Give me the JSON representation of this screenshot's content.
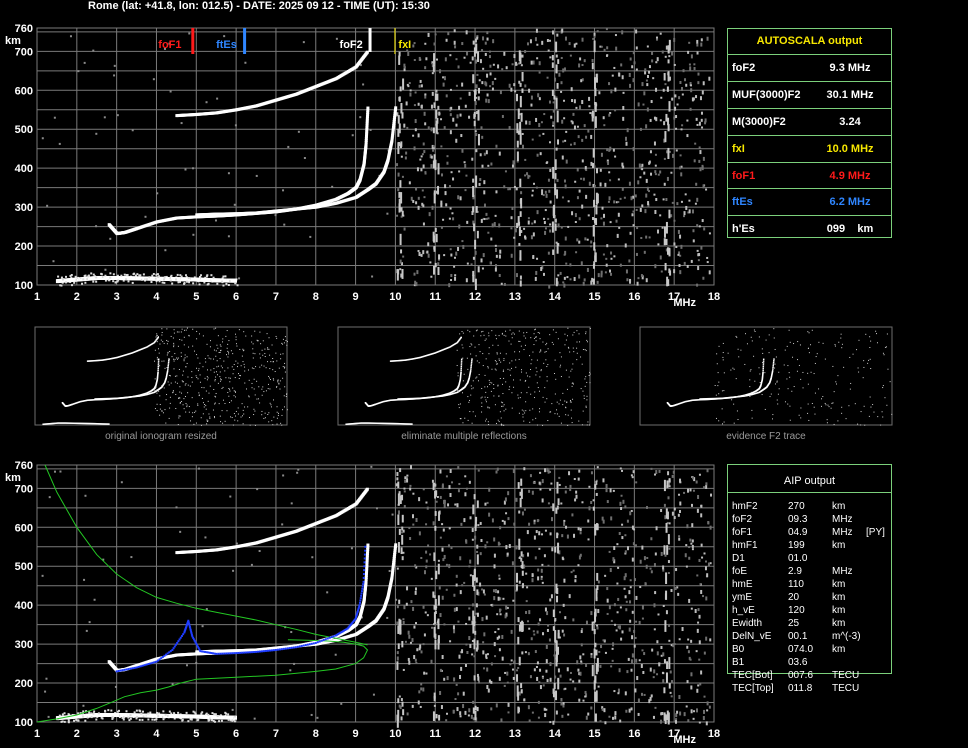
{
  "header": "Rome (lat: +41.8, lon: 012.5) - DATE: 2025 09 12 - TIME (UT): 15:30",
  "colors": {
    "grid": "#7a7a7a",
    "trace": "#ffffff",
    "green": "#23c623",
    "blue": "#1f3dff",
    "yellow": "#f7e700",
    "red": "#ff1a1a",
    "lightblue": "#2f86ff",
    "panel_border": "#7bd07b"
  },
  "chart_data": [
    {
      "type": "scatter",
      "title": "",
      "xlabel": "MHz",
      "ylabel": "km",
      "xlim": [
        1,
        18
      ],
      "ylim": [
        100,
        760
      ],
      "x_ticks": [
        "1",
        "2",
        "3",
        "4",
        "5",
        "6",
        "7",
        "8",
        "9",
        "10",
        "11",
        "12",
        "13",
        "14",
        "15",
        "16",
        "17",
        "18"
      ],
      "y_ticks": [
        "100",
        "200",
        "300",
        "400",
        "500",
        "600",
        "700",
        "760"
      ],
      "grid": true,
      "markers": [
        {
          "name": "foF1",
          "x": 4.9,
          "color": "#ff1a1a"
        },
        {
          "name": "ftEs",
          "x": 6.2,
          "color": "#2f86ff"
        },
        {
          "name": "foF2",
          "x": 9.3,
          "color": "#ffffff"
        },
        {
          "name": "fxI",
          "x": 10.0,
          "color": "#f7e700"
        }
      ],
      "series": [
        {
          "name": "O-trace",
          "x": [
            2.8,
            3.0,
            3.2,
            3.5,
            4.0,
            4.5,
            5.0,
            5.5,
            6.0,
            6.5,
            7.0,
            7.5,
            8.0,
            8.5,
            8.8,
            9.0,
            9.1,
            9.2,
            9.25,
            9.3
          ],
          "y": [
            255,
            232,
            235,
            245,
            262,
            272,
            275,
            277,
            280,
            284,
            288,
            295,
            305,
            320,
            335,
            350,
            370,
            410,
            460,
            560
          ]
        },
        {
          "name": "X-trace",
          "x": [
            5.0,
            5.5,
            6.0,
            6.5,
            7.0,
            7.5,
            8.0,
            8.5,
            9.0,
            9.3,
            9.5,
            9.7,
            9.8,
            9.9,
            10.0
          ],
          "y": [
            280,
            282,
            283,
            285,
            290,
            295,
            300,
            310,
            325,
            345,
            360,
            390,
            420,
            470,
            560
          ]
        },
        {
          "name": "multiple-reflection",
          "x": [
            4.5,
            5.0,
            5.5,
            6.0,
            6.5,
            7.0,
            7.5,
            8.0,
            8.5,
            9.0,
            9.3
          ],
          "y": [
            535,
            538,
            542,
            550,
            560,
            575,
            590,
            610,
            630,
            660,
            700
          ]
        },
        {
          "name": "E-layer",
          "x": [
            1.5,
            2.0,
            2.5,
            3.0,
            3.5,
            4.0,
            4.5,
            5.0,
            5.5,
            6.0
          ],
          "y": [
            110,
            114,
            118,
            118,
            117,
            116,
            115,
            114,
            112,
            111
          ]
        }
      ]
    },
    {
      "type": "line",
      "title": "",
      "xlabel": "MHz",
      "ylabel": "km",
      "xlim": [
        1,
        18
      ],
      "ylim": [
        100,
        760
      ],
      "x_ticks": [
        "1",
        "2",
        "3",
        "4",
        "5",
        "6",
        "7",
        "8",
        "9",
        "10",
        "11",
        "12",
        "13",
        "14",
        "15",
        "16",
        "17",
        "18"
      ],
      "y_ticks": [
        "100",
        "200",
        "300",
        "400",
        "500",
        "600",
        "700",
        "760"
      ],
      "grid": true,
      "series": [
        {
          "name": "MUF curve",
          "color": "#23c623",
          "x": [
            1.2,
            1.5,
            2.0,
            2.5,
            3.0,
            3.5,
            4.0,
            4.5,
            5.0,
            5.5,
            6.0,
            6.5,
            7.0,
            7.5,
            8.0,
            8.5,
            9.0,
            9.3
          ],
          "y": [
            760,
            690,
            600,
            530,
            480,
            445,
            420,
            405,
            392,
            382,
            372,
            362,
            350,
            338,
            325,
            315,
            305,
            298
          ]
        },
        {
          "name": "Profile",
          "color": "#23c623",
          "x": [
            1.0,
            1.5,
            2.0,
            2.5,
            2.9,
            3.2,
            3.6,
            4.0,
            4.3,
            4.6,
            5.0,
            6.0,
            7.0,
            8.0,
            8.5,
            9.0,
            9.2,
            9.3,
            9.2,
            9.0,
            8.7,
            8.3,
            7.8,
            7.3
          ],
          "y": [
            100,
            108,
            118,
            135,
            152,
            165,
            175,
            182,
            190,
            200,
            210,
            215,
            220,
            230,
            236,
            250,
            265,
            285,
            295,
            300,
            305,
            308,
            310,
            311
          ]
        },
        {
          "name": "Scaled O-trace",
          "color": "#1f3dff",
          "x": [
            3.0,
            3.5,
            4.0,
            4.4,
            4.7,
            4.8,
            4.9,
            5.1,
            5.5,
            6.0,
            6.5,
            7.0,
            7.5,
            8.0,
            8.5,
            8.8,
            9.0,
            9.1,
            9.2,
            9.25
          ],
          "y": [
            230,
            240,
            255,
            285,
            330,
            360,
            320,
            282,
            275,
            277,
            280,
            285,
            292,
            303,
            322,
            340,
            365,
            400,
            460,
            560
          ]
        }
      ]
    }
  ],
  "mini_panels": [
    {
      "caption": "original ionogram resized"
    },
    {
      "caption": "eliminate multiple reflections"
    },
    {
      "caption": "evidence F2 trace"
    }
  ],
  "autoscala": {
    "title": "AUTOSCALA output",
    "rows": [
      {
        "label": "foF2",
        "value": "9.3 MHz",
        "color": "#ffffff"
      },
      {
        "label": "MUF(3000)F2",
        "value": "30.1 MHz",
        "color": "#ffffff"
      },
      {
        "label": "M(3000)F2",
        "value": "3.24",
        "color": "#ffffff"
      },
      {
        "label": "fxI",
        "value": "10.0 MHz",
        "color": "#f7e700"
      },
      {
        "label": "foF1",
        "value": "4.9 MHz",
        "color": "#ff1a1a"
      },
      {
        "label": "ftEs",
        "value": "6.2 MHz",
        "color": "#2f86ff"
      },
      {
        "label": "h'Es",
        "value": "099    km",
        "color": "#ffffff"
      }
    ]
  },
  "aip": {
    "title": "AIP output",
    "rows": [
      {
        "label": "hmF2",
        "value": "270",
        "unit": "km",
        "extra": ""
      },
      {
        "label": "foF2",
        "value": "09.3",
        "unit": "MHz",
        "extra": ""
      },
      {
        "label": "foF1",
        "value": "04.9",
        "unit": "MHz",
        "extra": "[PY]"
      },
      {
        "label": "hmF1",
        "value": "199",
        "unit": "km",
        "extra": ""
      },
      {
        "label": "D1",
        "value": "01.0",
        "unit": "",
        "extra": ""
      },
      {
        "label": "foE",
        "value": "2.9",
        "unit": "MHz",
        "extra": ""
      },
      {
        "label": "hmE",
        "value": "110",
        "unit": "km",
        "extra": ""
      },
      {
        "label": "ymE",
        "value": "20",
        "unit": "km",
        "extra": ""
      },
      {
        "label": "h_vE",
        "value": "120",
        "unit": "km",
        "extra": ""
      },
      {
        "label": "Ewidth",
        "value": "25",
        "unit": "km",
        "extra": ""
      },
      {
        "label": "DelN_vE",
        "value": "00.1",
        "unit": "m^(-3)",
        "extra": ""
      },
      {
        "label": "B0",
        "value": "074.0",
        "unit": "km",
        "extra": ""
      },
      {
        "label": "B1",
        "value": "03.6",
        "unit": "",
        "extra": ""
      },
      {
        "label": "TEC[Bot]",
        "value": "007.6",
        "unit": "TECU",
        "extra": ""
      },
      {
        "label": "TEC[Top]",
        "value": "011.8",
        "unit": "TECU",
        "extra": ""
      }
    ]
  }
}
